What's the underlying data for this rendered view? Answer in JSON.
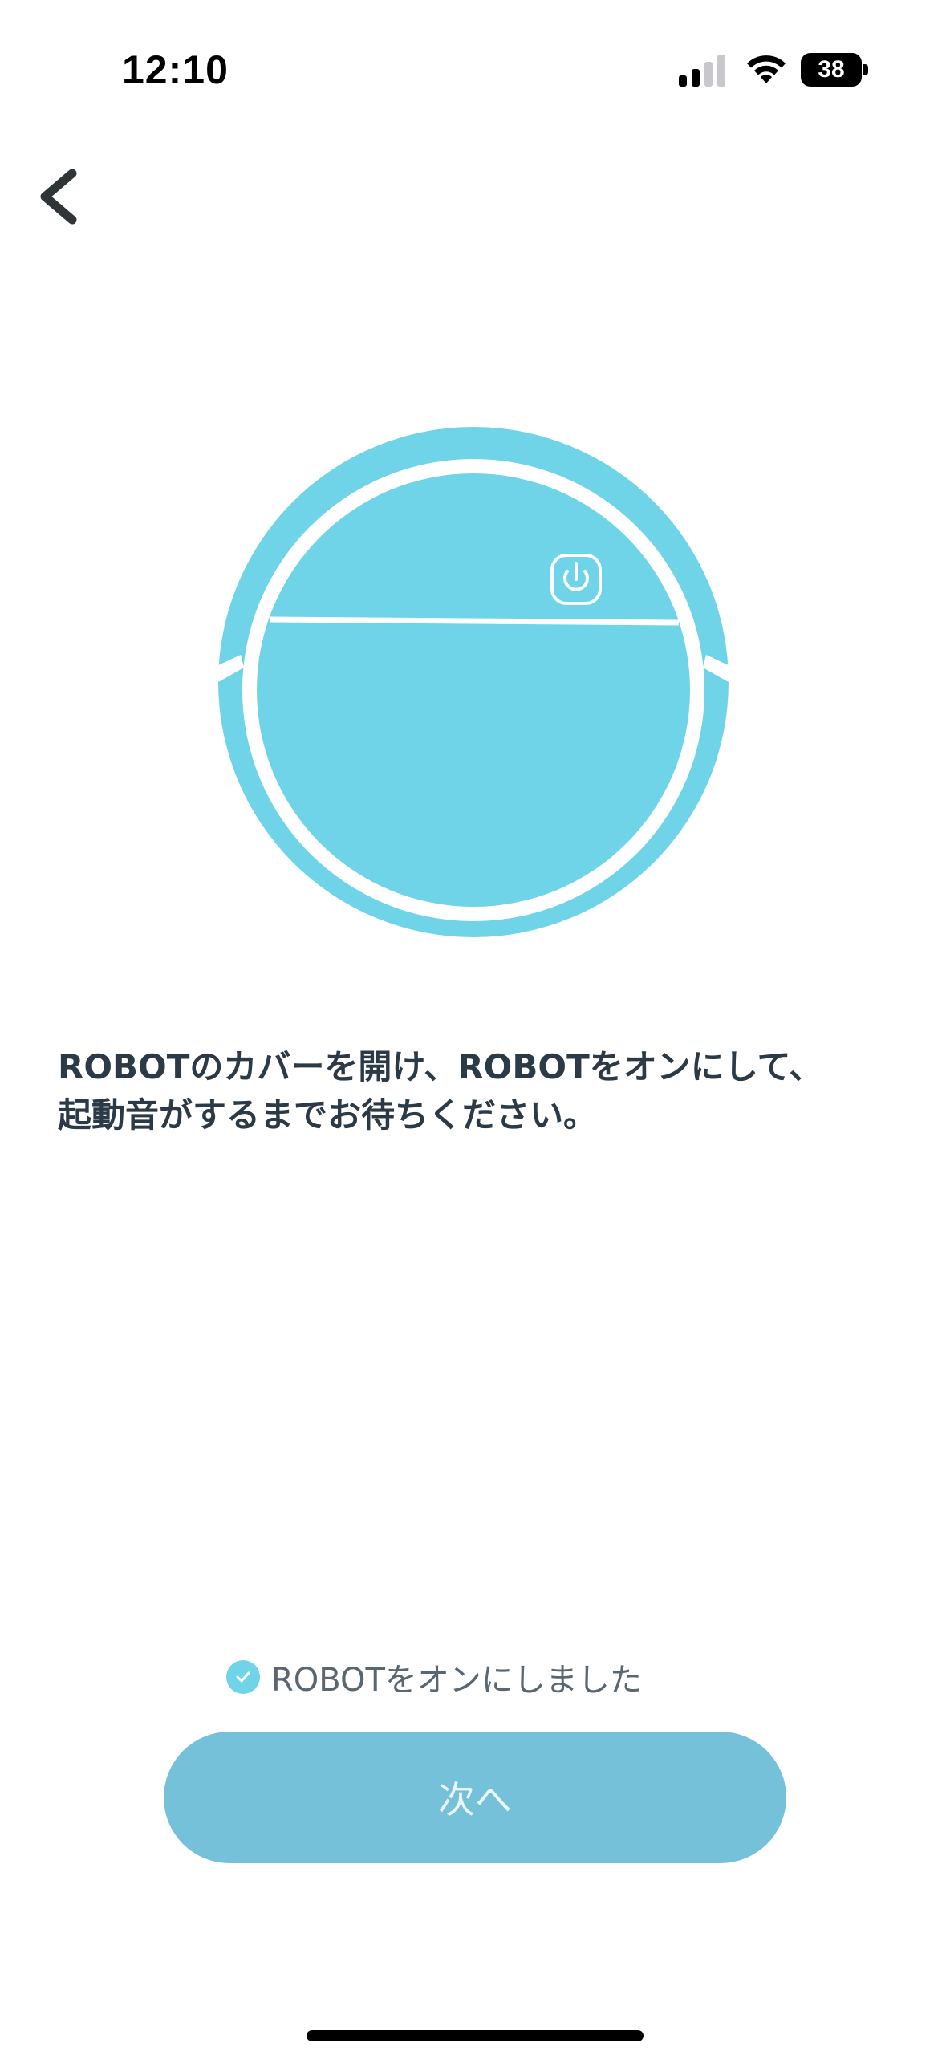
{
  "status_bar": {
    "time": "12:10",
    "battery_level": "38",
    "signal_bars_active": 2,
    "signal_bars_total": 4
  },
  "navigation": {
    "back_icon": "chevron-left-icon"
  },
  "illustration": {
    "device": "robot-vacuum-icon",
    "power_icon": "power-icon",
    "color": "#6fd4e8"
  },
  "instruction": {
    "line1": "ROBOTのカバーを開け、ROBOTをオンにして、",
    "line2": "起動音がするまでお待ちください。"
  },
  "confirmation": {
    "label": "ROBOTをオンにしました",
    "checked": true,
    "icon": "check-circle-icon"
  },
  "next_button": {
    "label": "次へ"
  },
  "colors": {
    "accent": "#6fd4e8",
    "button": "#76c1da",
    "text_primary": "#2b3a46",
    "text_secondary": "#5a6670"
  }
}
